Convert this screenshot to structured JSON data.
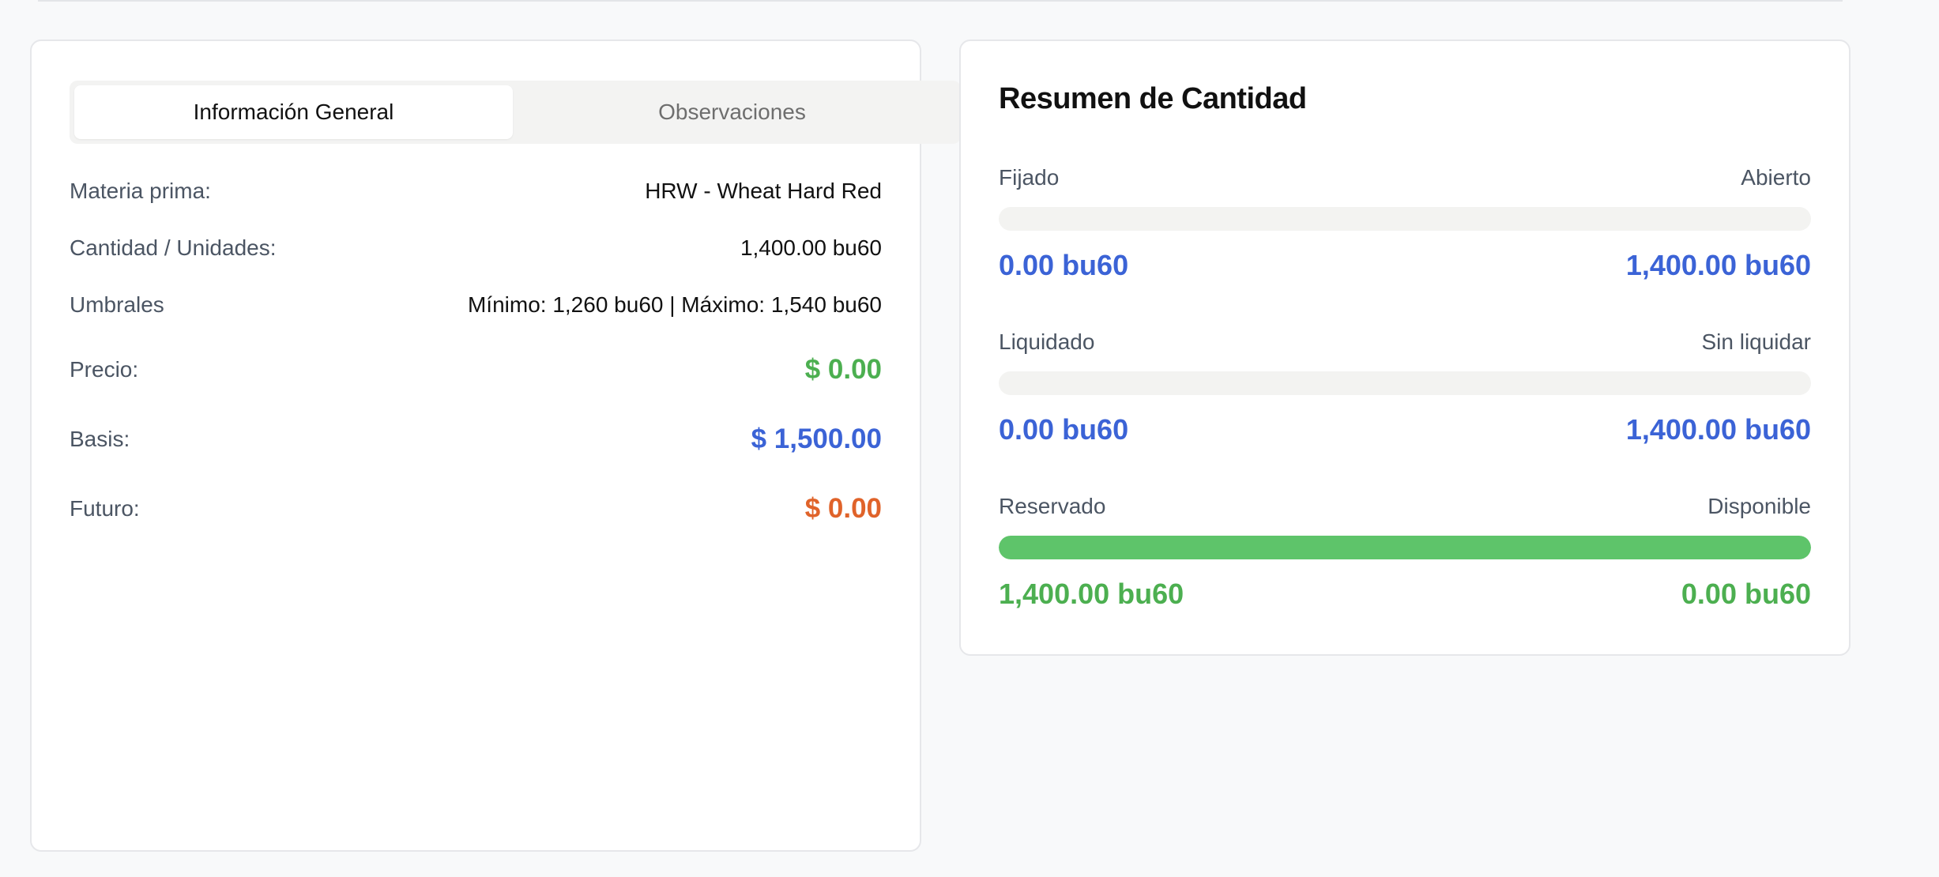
{
  "tabs": [
    {
      "label": "Información General",
      "active": true
    },
    {
      "label": "Observaciones",
      "active": false
    }
  ],
  "info": {
    "materia_prima": {
      "label": "Materia prima:",
      "value": "HRW - Wheat Hard Red"
    },
    "cantidad": {
      "label": "Cantidad / Unidades:",
      "value": "1,400.00 bu60"
    },
    "umbrales": {
      "label": "Umbrales",
      "value": "Mínimo: 1,260 bu60 | Máximo: 1,540 bu60"
    },
    "precio": {
      "label": "Precio:",
      "value": "$ 0.00",
      "color": "#4caf50"
    },
    "basis": {
      "label": "Basis:",
      "value": "$ 1,500.00",
      "color": "#3b63d6"
    },
    "futuro": {
      "label": "Futuro:",
      "value": "$ 0.00",
      "color": "#e0632a"
    }
  },
  "summary": {
    "title": "Resumen de Cantidad",
    "bars": [
      {
        "left_label": "Fijado",
        "right_label": "Abierto",
        "left_value": "0.00 bu60",
        "right_value": "1,400.00 bu60",
        "fill_fraction": 0,
        "value_color": "#3b63d6"
      },
      {
        "left_label": "Liquidado",
        "right_label": "Sin liquidar",
        "left_value": "0.00 bu60",
        "right_value": "1,400.00 bu60",
        "fill_fraction": 0,
        "value_color": "#3b63d6"
      },
      {
        "left_label": "Reservado",
        "right_label": "Disponible",
        "left_value": "1,400.00 bu60",
        "right_value": "0.00 bu60",
        "fill_fraction": 1,
        "value_color": "#4caf50"
      }
    ]
  },
  "colors": {
    "page_bg": "#f8f9fa",
    "card_bg": "#ffffff",
    "bar_track": "#f3f3f1",
    "bar_fill": "#5ec46a"
  }
}
